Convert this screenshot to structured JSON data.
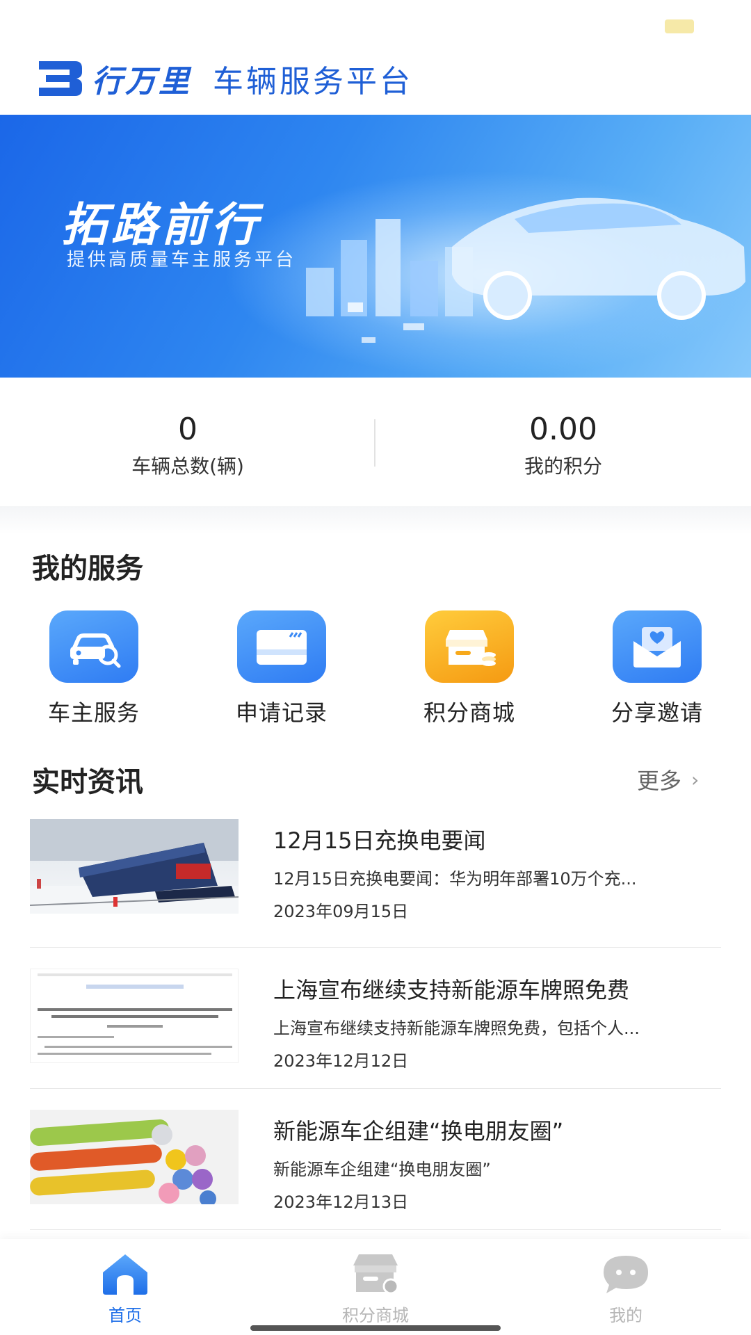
{
  "header": {
    "brand": "行万里",
    "platform": "车辆服务平台"
  },
  "banner": {
    "title": "拓路前行",
    "subtitle": "提供高质量车主服务平台"
  },
  "stats": [
    {
      "value": "0",
      "label": "车辆总数(辆)"
    },
    {
      "value": "0.00",
      "label": "我的积分"
    }
  ],
  "services": {
    "title": "我的服务",
    "items": [
      {
        "label": "车主服务",
        "icon": "car-search-icon",
        "color": "#3b8af5"
      },
      {
        "label": "申请记录",
        "icon": "card-icon",
        "color": "#3b8af5"
      },
      {
        "label": "积分商城",
        "icon": "shop-icon",
        "color": "#f7a91b"
      },
      {
        "label": "分享邀请",
        "icon": "envelope-heart-icon",
        "color": "#3b8af5"
      }
    ]
  },
  "news": {
    "title": "实时资讯",
    "more": "更多",
    "items": [
      {
        "title": "12月15日充换电要闻",
        "summary": "12月15日充换电要闻：华为明年部署10万个充...",
        "date": "2023年09月15日"
      },
      {
        "title": "上海宣布继续支持新能源车牌照免费",
        "summary": "上海宣布继续支持新能源车牌照免费，包括个人...",
        "date": "2023年12月12日"
      },
      {
        "title": "新能源车企组建“换电朋友圈”",
        "summary": "新能源车企组建“换电朋友圈”",
        "date": "2023年12月13日"
      }
    ]
  },
  "tabbar": {
    "active_color": "#1f6fe8",
    "inactive_color": "#b6b6b6",
    "items": [
      {
        "label": "首页",
        "icon": "home-icon"
      },
      {
        "label": "积分商城",
        "icon": "shop-icon"
      },
      {
        "label": "我的",
        "icon": "chat-face-icon"
      }
    ]
  }
}
